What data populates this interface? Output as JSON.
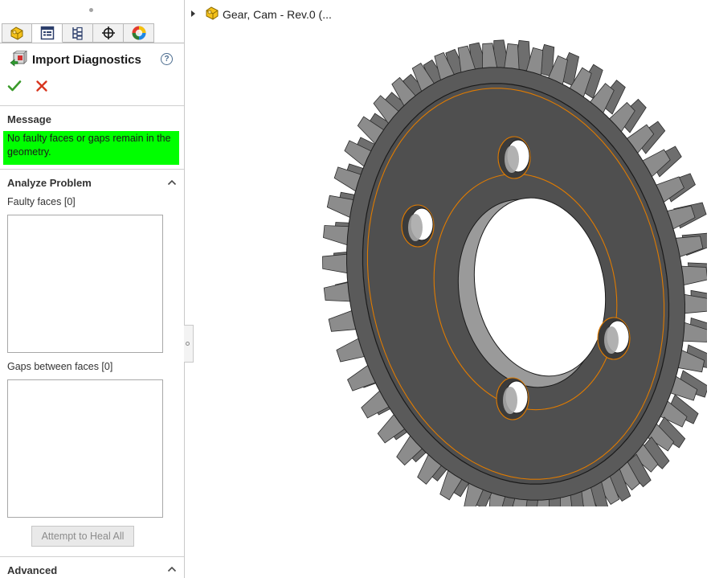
{
  "panel": {
    "title": "Import Diagnostics",
    "help_glyph": "?",
    "tabs": [
      {
        "icon": "part-icon"
      },
      {
        "icon": "property-manager-icon"
      },
      {
        "icon": "configuration-manager-icon"
      },
      {
        "icon": "dimxpert-icon"
      },
      {
        "icon": "display-manager-icon"
      }
    ],
    "ok_icon": "checkmark-icon",
    "cancel_icon": "x-icon",
    "message": {
      "section_title": "Message",
      "text": "No faulty faces or gaps remain in the geometry.",
      "background": "#00ff00"
    },
    "analyze": {
      "section_title": "Analyze Problem",
      "faulty_faces_label": "Faulty faces [0]",
      "gaps_label": "Gaps between faces [0]",
      "heal_button": "Attempt to Heal All"
    },
    "advanced": {
      "section_title": "Advanced"
    }
  },
  "tree": {
    "label": "Gear, Cam - Rev.0  (..."
  },
  "colors": {
    "accent_green": "#00ff00",
    "edge_highlight": "#e07b00",
    "gear_body": "#4f4f4f",
    "teeth": "#8c8c8c"
  }
}
